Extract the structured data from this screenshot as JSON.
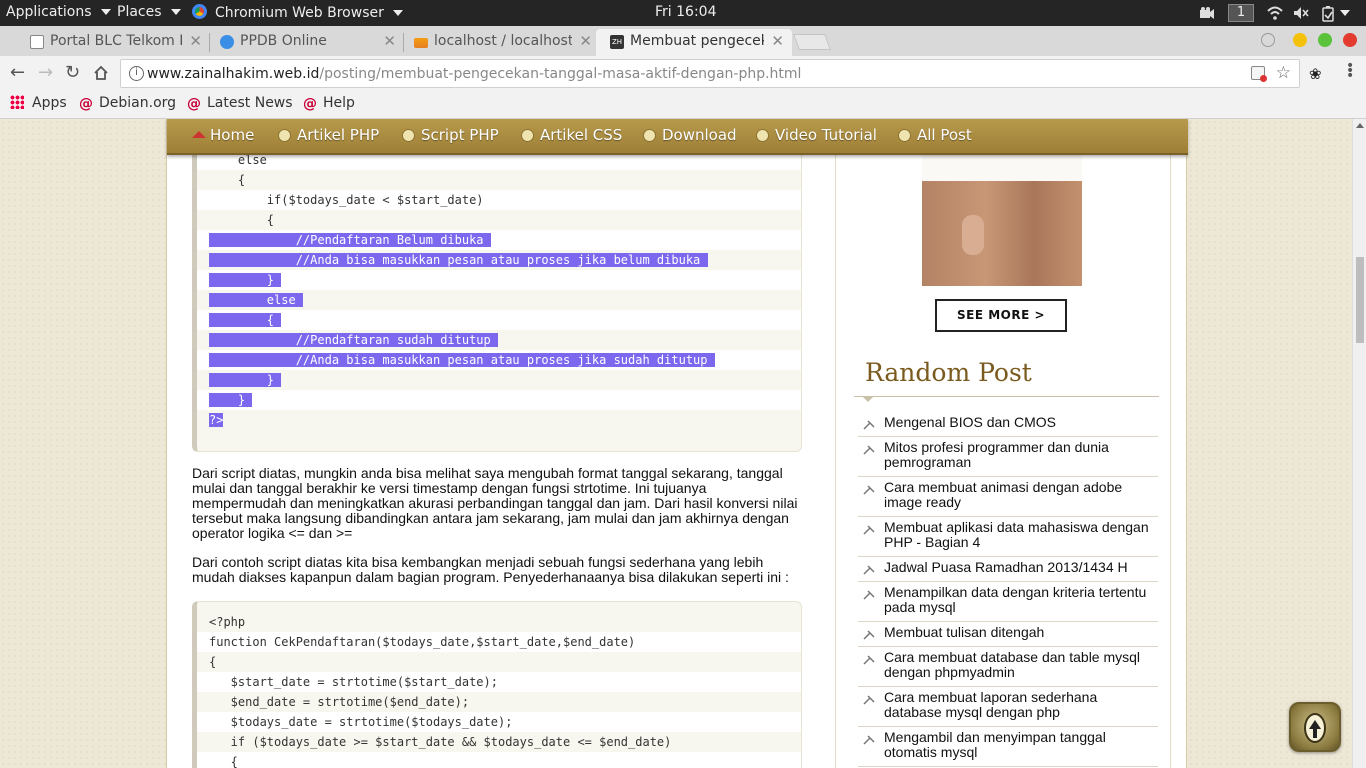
{
  "system_bar": {
    "applications": "Applications",
    "places": "Places",
    "browser": "Chromium Web Browser",
    "clock": "Fri 16:04",
    "workspace": "1"
  },
  "tabs": [
    {
      "title": "Portal BLC Telkom K",
      "favicon_color": "#888888"
    },
    {
      "title": "PPDB Online",
      "favicon_color": "#3a8ee6"
    },
    {
      "title": "localhost / localhost",
      "favicon_color": "#f39c12"
    },
    {
      "title": "Membuat pengecek",
      "favicon_color": "#333333"
    }
  ],
  "toolbar": {
    "url_host": "www.zainalhakim.web.id",
    "url_path": "/posting/membuat-pengecekan-tanggal-masa-aktif-dengan-php.html"
  },
  "bookmarks": [
    {
      "label": "Apps",
      "icon": "apps-grid-icon"
    },
    {
      "label": "Debian.org",
      "icon": "debian-swirl-icon"
    },
    {
      "label": "Latest News",
      "icon": "debian-swirl-icon"
    },
    {
      "label": "Help",
      "icon": "debian-swirl-icon"
    }
  ],
  "site_nav": [
    {
      "label": "Home",
      "icon": "home-icon"
    },
    {
      "label": "Artikel PHP",
      "icon": "bullet-icon"
    },
    {
      "label": "Script PHP",
      "icon": "bullet-icon"
    },
    {
      "label": "Artikel CSS",
      "icon": "bullet-icon"
    },
    {
      "label": "Download",
      "icon": "bullet-icon"
    },
    {
      "label": "Video Tutorial",
      "icon": "bullet-icon"
    },
    {
      "label": "All Post",
      "icon": "bullet-icon"
    }
  ],
  "code_block_1": [
    {
      "pre": "    }",
      "hl": ""
    },
    {
      "pre": "    else",
      "hl": ""
    },
    {
      "pre": "    {",
      "hl": ""
    },
    {
      "pre": "        if($todays_date < $start_date)",
      "hl": ""
    },
    {
      "pre": "        {",
      "hl": ""
    },
    {
      "pre": "",
      "hl": "            //Pendaftaran Belum dibuka "
    },
    {
      "pre": "",
      "hl": "            //Anda bisa masukkan pesan atau proses jika belum dibuka "
    },
    {
      "pre": "",
      "hl": "        } "
    },
    {
      "pre": "",
      "hl": "        else "
    },
    {
      "pre": "",
      "hl": "        { "
    },
    {
      "pre": "",
      "hl": "            //Pendaftaran sudah ditutup "
    },
    {
      "pre": "",
      "hl": "            //Anda bisa masukkan pesan atau proses jika sudah ditutup "
    },
    {
      "pre": "",
      "hl": "        } "
    },
    {
      "pre": "",
      "hl": "    } "
    },
    {
      "pre": "",
      "hl": "?>"
    }
  ],
  "paragraph_1": "Dari script diatas, mungkin anda bisa melihat saya mengubah format tanggal sekarang, tanggal mulai dan tanggal berakhir ke versi timestamp dengan fungsi strtotime. Ini tujuanya mempermudah dan meningkatkan akurasi perbandingan tanggal dan jam. Dari hasil konversi nilai tersebut maka langsung dibandingkan antara jam sekarang, jam mulai dan jam akhirnya dengan operator logika <= dan >=",
  "paragraph_2": "Dari contoh script diatas kita bisa kembangkan menjadi sebuah fungsi sederhana yang lebih mudah diakses kapanpun dalam bagian program. Penyederhanaanya bisa dilakukan seperti ini :",
  "code_block_2": [
    "<?php",
    "function CekPendaftaran($todays_date,$start_date,$end_date)",
    "{",
    "   $start_date = strtotime($start_date);",
    "   $end_date = strtotime($end_date);",
    "   $todays_date = strtotime($todays_date);",
    "   if ($todays_date >= $start_date && $todays_date <= $end_date)",
    "   {"
  ],
  "sidebar": {
    "see_more": "SEE MORE >",
    "random_post_title": "Random Post",
    "random_posts": [
      "Mengenal BIOS dan CMOS",
      "Mitos profesi programmer dan dunia pemrograman",
      "Cara membuat animasi dengan adobe image ready",
      "Membuat aplikasi data mahasiswa dengan PHP - Bagian 4",
      "Jadwal Puasa Ramadhan 2013/1434 H",
      "Menampilkan data dengan kriteria tertentu pada mysql",
      "Membuat tulisan ditengah",
      "Cara membuat database dan table mysql dengan phpmyadmin",
      "Cara membuat laporan sederhana database mysql dengan php",
      "Mengambil dan menyimpan tanggal otomatis mysql"
    ]
  }
}
